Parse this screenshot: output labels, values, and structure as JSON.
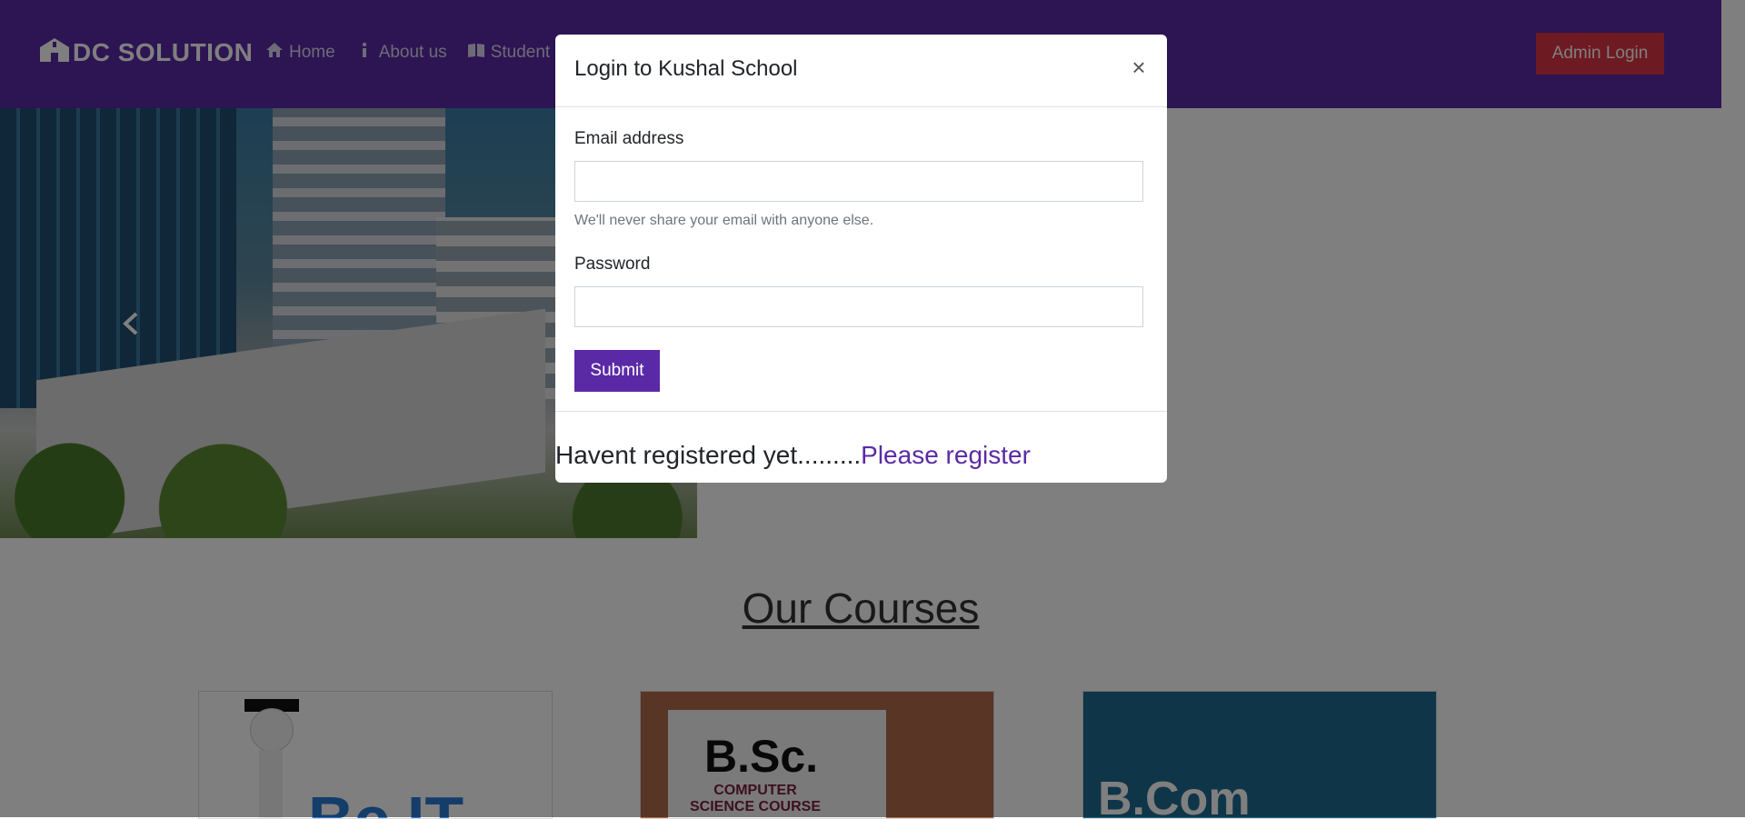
{
  "navbar": {
    "brand": "DC SOLUTION",
    "links": [
      {
        "label": "Home",
        "icon": "home-icon"
      },
      {
        "label": "About us",
        "icon": "info-icon"
      },
      {
        "label": "Student C",
        "icon": "book-icon"
      }
    ],
    "admin_login": "Admin Login"
  },
  "courses": {
    "title": "Our Courses",
    "cards": [
      {
        "text": "Bc IT"
      },
      {
        "text": "B.Sc.",
        "sub": "COMPUTER SCIENCE COURSE"
      },
      {
        "text": "B.Com"
      }
    ]
  },
  "modal": {
    "title": "Login to Kushal School",
    "close": "×",
    "email_label": "Email address",
    "email_value": "",
    "email_help": "We'll never share your email with anyone else.",
    "password_label": "Password",
    "password_value": "",
    "submit": "Submit",
    "register_prompt": "Havent registered yet.........",
    "register_link": "Please register"
  },
  "colors": {
    "primary": "#5a2aa6",
    "danger": "#dc3545"
  }
}
